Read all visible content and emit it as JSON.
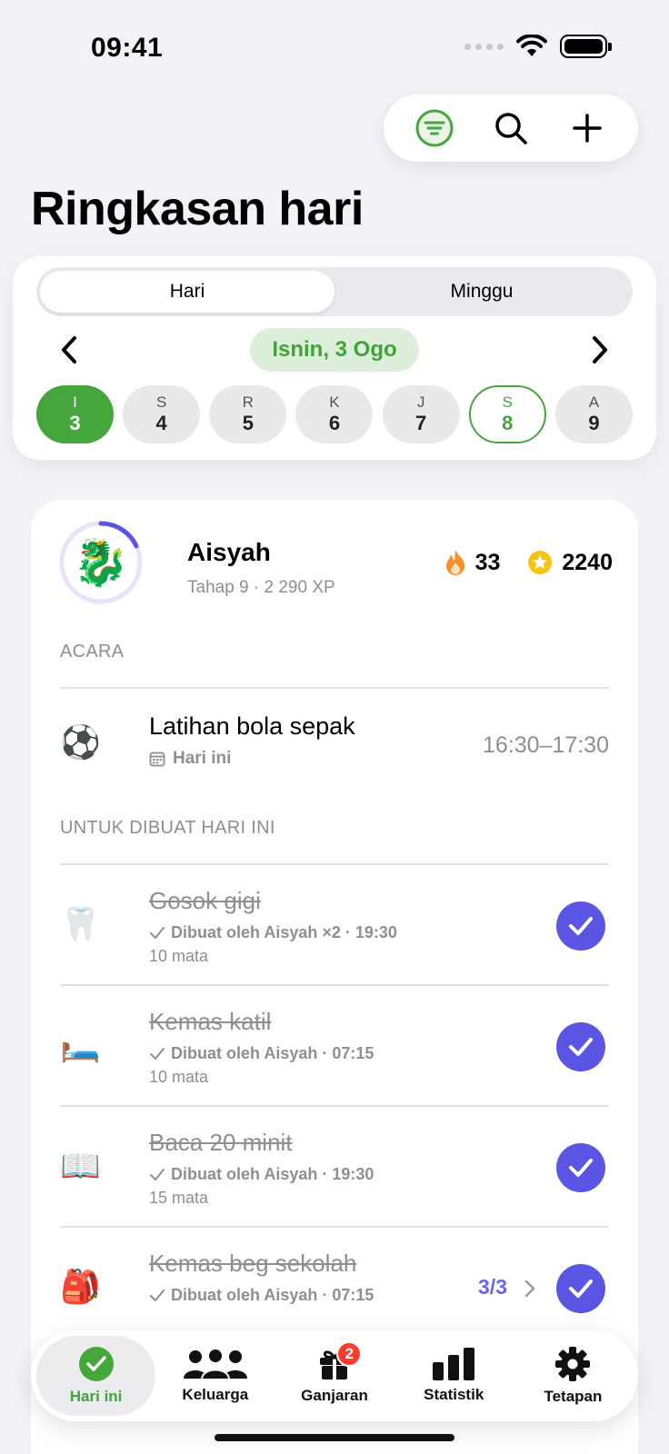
{
  "status": {
    "time": "09:41"
  },
  "header": {
    "title": "Ringkasan hari"
  },
  "segmented": {
    "day": "Hari",
    "week": "Minggu"
  },
  "date_nav": {
    "current": "Isnin, 3 Ogo"
  },
  "days": [
    {
      "letter": "I",
      "num": "3"
    },
    {
      "letter": "S",
      "num": "4"
    },
    {
      "letter": "R",
      "num": "5"
    },
    {
      "letter": "K",
      "num": "6"
    },
    {
      "letter": "J",
      "num": "7"
    },
    {
      "letter": "S",
      "num": "8"
    },
    {
      "letter": "A",
      "num": "9"
    }
  ],
  "profile": {
    "name": "Aisyah",
    "subtitle": "Tahap 9 · 2 290 XP",
    "avatar": "🐉",
    "level_progress": 0.18,
    "streak": "33",
    "coins": "2240"
  },
  "sections": {
    "events": "ACARA",
    "todo": "UNTUK DIBUAT HARI INI"
  },
  "event": {
    "emoji": "⚽",
    "title": "Latihan bola sepak",
    "sub": "Hari ini",
    "time": "16:30–17:30"
  },
  "tasks": [
    {
      "emoji": "🦷",
      "title": "Gosok gigi",
      "done": "Dibuat oleh Aisyah ×2 · 19:30",
      "points": "10 mata"
    },
    {
      "emoji": "🛏️",
      "title": "Kemas katil",
      "done": "Dibuat oleh Aisyah · 07:15",
      "points": "10 mata"
    },
    {
      "emoji": "📖",
      "title": "Baca 20 minit",
      "done": "Dibuat oleh Aisyah · 19:30",
      "points": "15 mata"
    },
    {
      "emoji": "🎒",
      "title": "Kemas beg sekolah",
      "done": "Dibuat oleh Aisyah · 07:15",
      "points": "",
      "progress": "3/3"
    }
  ],
  "tabs": [
    {
      "label": "Hari ini"
    },
    {
      "label": "Keluarga"
    },
    {
      "label": "Ganjaran",
      "badge": "2"
    },
    {
      "label": "Statistik"
    },
    {
      "label": "Tetapan"
    }
  ],
  "colors": {
    "accent_green": "#45a63c",
    "accent_purple": "#5a55e3",
    "badge_red": "#ff3b30"
  }
}
